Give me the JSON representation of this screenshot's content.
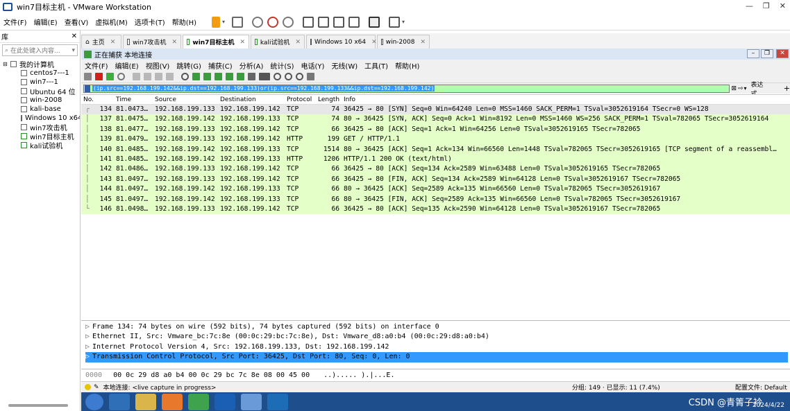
{
  "vmware": {
    "title": "win7目标主机 - VMware Workstation",
    "menu": [
      "文件(F)",
      "编辑(E)",
      "查看(V)",
      "虚拟机(M)",
      "选项卡(T)",
      "帮助(H)"
    ],
    "library": {
      "title": "库",
      "search_placeholder": "在此处键入内容...",
      "root": "我的计算机",
      "items": [
        "centos7---1",
        "win7---1",
        "Ubuntu 64 位",
        "win-2008",
        "kali-base",
        "Windows 10 x64",
        "win7攻击机",
        "win7目标主机",
        "kali试验机"
      ]
    },
    "tabs": [
      {
        "label": "主页",
        "active": false
      },
      {
        "label": "win7攻击机",
        "active": false
      },
      {
        "label": "win7目标主机",
        "active": true
      },
      {
        "label": "kali试验机",
        "active": false
      },
      {
        "label": "Windows 10 x64",
        "active": false
      },
      {
        "label": "win-2008",
        "active": false
      }
    ]
  },
  "wireshark": {
    "title": "正在捕获 本地连接",
    "menu": [
      "文件(F)",
      "编辑(E)",
      "视图(V)",
      "跳转(G)",
      "捕获(C)",
      "分析(A)",
      "统计(S)",
      "电话(Y)",
      "无线(W)",
      "工具(T)",
      "帮助(H)"
    ],
    "filter": "(ip.src==192.168.199.142&&ip.dst==192.168.199.133)or(ip.src==192.168.199.133&&ip.dst==192.168.199.142)",
    "expr_label": "表达式…",
    "columns": [
      "No.",
      "Time",
      "Source",
      "Destination",
      "Protocol",
      "Length",
      "Info"
    ],
    "packets": [
      {
        "no": "134",
        "time": "81.0473…",
        "src": "192.168.199.133",
        "dst": "192.168.199.142",
        "proto": "TCP",
        "len": "74",
        "info": "36425 → 80 [SYN] Seq=0 Win=64240 Len=0 MSS=1460 SACK_PERM=1 TSval=3052619164 TSecr=0 WS=128"
      },
      {
        "no": "137",
        "time": "81.0475…",
        "src": "192.168.199.142",
        "dst": "192.168.199.133",
        "proto": "TCP",
        "len": "74",
        "info": "80 → 36425 [SYN, ACK] Seq=0 Ack=1 Win=8192 Len=0 MSS=1460 WS=256 SACK_PERM=1 TSval=782065 TSecr=3052619164"
      },
      {
        "no": "138",
        "time": "81.0477…",
        "src": "192.168.199.133",
        "dst": "192.168.199.142",
        "proto": "TCP",
        "len": "66",
        "info": "36425 → 80 [ACK] Seq=1 Ack=1 Win=64256 Len=0 TSval=3052619165 TSecr=782065"
      },
      {
        "no": "139",
        "time": "81.0479…",
        "src": "192.168.199.133",
        "dst": "192.168.199.142",
        "proto": "HTTP",
        "len": "199",
        "info": "GET / HTTP/1.1"
      },
      {
        "no": "140",
        "time": "81.0485…",
        "src": "192.168.199.142",
        "dst": "192.168.199.133",
        "proto": "TCP",
        "len": "1514",
        "info": "80 → 36425 [ACK] Seq=1 Ack=134 Win=66560 Len=1448 TSval=782065 TSecr=3052619165 [TCP segment of a reassembl…"
      },
      {
        "no": "141",
        "time": "81.0485…",
        "src": "192.168.199.142",
        "dst": "192.168.199.133",
        "proto": "HTTP",
        "len": "1206",
        "info": "HTTP/1.1 200 OK  (text/html)"
      },
      {
        "no": "142",
        "time": "81.0486…",
        "src": "192.168.199.133",
        "dst": "192.168.199.142",
        "proto": "TCP",
        "len": "66",
        "info": "36425 → 80 [ACK] Seq=134 Ack=2589 Win=63488 Len=0 TSval=3052619165 TSecr=782065"
      },
      {
        "no": "143",
        "time": "81.0497…",
        "src": "192.168.199.133",
        "dst": "192.168.199.142",
        "proto": "TCP",
        "len": "66",
        "info": "36425 → 80 [FIN, ACK] Seq=134 Ack=2589 Win=64128 Len=0 TSval=3052619167 TSecr=782065"
      },
      {
        "no": "144",
        "time": "81.0497…",
        "src": "192.168.199.142",
        "dst": "192.168.199.133",
        "proto": "TCP",
        "len": "66",
        "info": "80 → 36425 [ACK] Seq=2589 Ack=135 Win=66560 Len=0 TSval=782065 TSecr=3052619167"
      },
      {
        "no": "145",
        "time": "81.0497…",
        "src": "192.168.199.142",
        "dst": "192.168.199.133",
        "proto": "TCP",
        "len": "66",
        "info": "80 → 36425 [FIN, ACK] Seq=2589 Ack=135 Win=66560 Len=0 TSval=782065 TSecr=3052619167"
      },
      {
        "no": "146",
        "time": "81.0498…",
        "src": "192.168.199.133",
        "dst": "192.168.199.142",
        "proto": "TCP",
        "len": "66",
        "info": "36425 → 80 [ACK] Seq=135 Ack=2590 Win=64128 Len=0 TSval=3052619167 TSecr=782065"
      }
    ],
    "details": [
      "Frame 134: 74 bytes on wire (592 bits), 74 bytes captured (592 bits) on interface 0",
      "Ethernet II, Src: Vmware_bc:7c:8e (00:0c:29:bc:7c:8e), Dst: Vmware_d8:a0:b4 (00:0c:29:d8:a0:b4)",
      "Internet Protocol Version 4, Src: 192.168.199.133, Dst: 192.168.199.142",
      "Transmission Control Protocol, Src Port: 36425, Dst Port: 80, Seq: 0, Len: 0"
    ],
    "bytes": {
      "offset": "0000",
      "hex": "00 0c 29 d8 a0 b4 00 0c  29 bc 7c 8e 08 00 45 00",
      "ascii": "..)..... ).|...E."
    },
    "status": {
      "left": "本地连接: <live capture in progress>",
      "stats": "分组: 149 · 已显示: 11 (7.4%)",
      "profile": "配置文件: Default"
    },
    "colors": {
      "row_green": "#e4ffc7",
      "selected_detail": "#3399ff",
      "filter_bg": "#afffaf"
    }
  },
  "taskbar": {
    "date": "2024/4/22",
    "watermark": "CSDN @青箐子衿"
  }
}
